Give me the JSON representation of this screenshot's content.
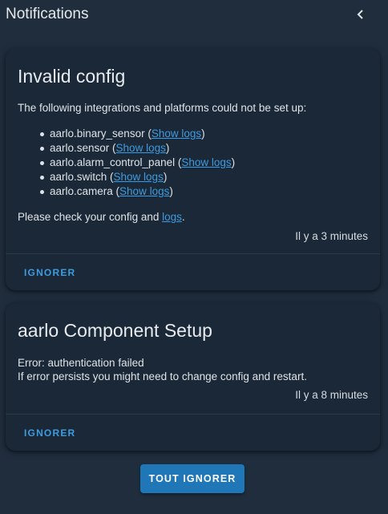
{
  "header": {
    "title": "Notifications",
    "close_icon": "chevron-left-icon"
  },
  "notifications": [
    {
      "title": "Invalid config",
      "intro": "The following integrations and platforms could not be set up:",
      "items": [
        {
          "name": "aarlo.binary_sensor",
          "link": "Show logs"
        },
        {
          "name": "aarlo.sensor",
          "link": "Show logs"
        },
        {
          "name": "aarlo.alarm_control_panel",
          "link": "Show logs"
        },
        {
          "name": "aarlo.switch",
          "link": "Show logs"
        },
        {
          "name": "aarlo.camera",
          "link": "Show logs"
        }
      ],
      "check_prefix": "Please check your config and ",
      "check_link": "logs",
      "check_suffix": ".",
      "timestamp": "Il y a 3 minutes",
      "dismiss_label": "IGNORER"
    },
    {
      "title": "aarlo Component Setup",
      "line1": "Error: authentication failed",
      "line2": "If error persists you might need to change config and restart.",
      "timestamp": "Il y a 8 minutes",
      "dismiss_label": "IGNORER"
    }
  ],
  "dismiss_all_label": "TOUT IGNORER",
  "colors": {
    "background": "#1f2d3d",
    "card": "#1b2837",
    "accent": "#3d9be0",
    "primary_button": "#1f77b8"
  }
}
